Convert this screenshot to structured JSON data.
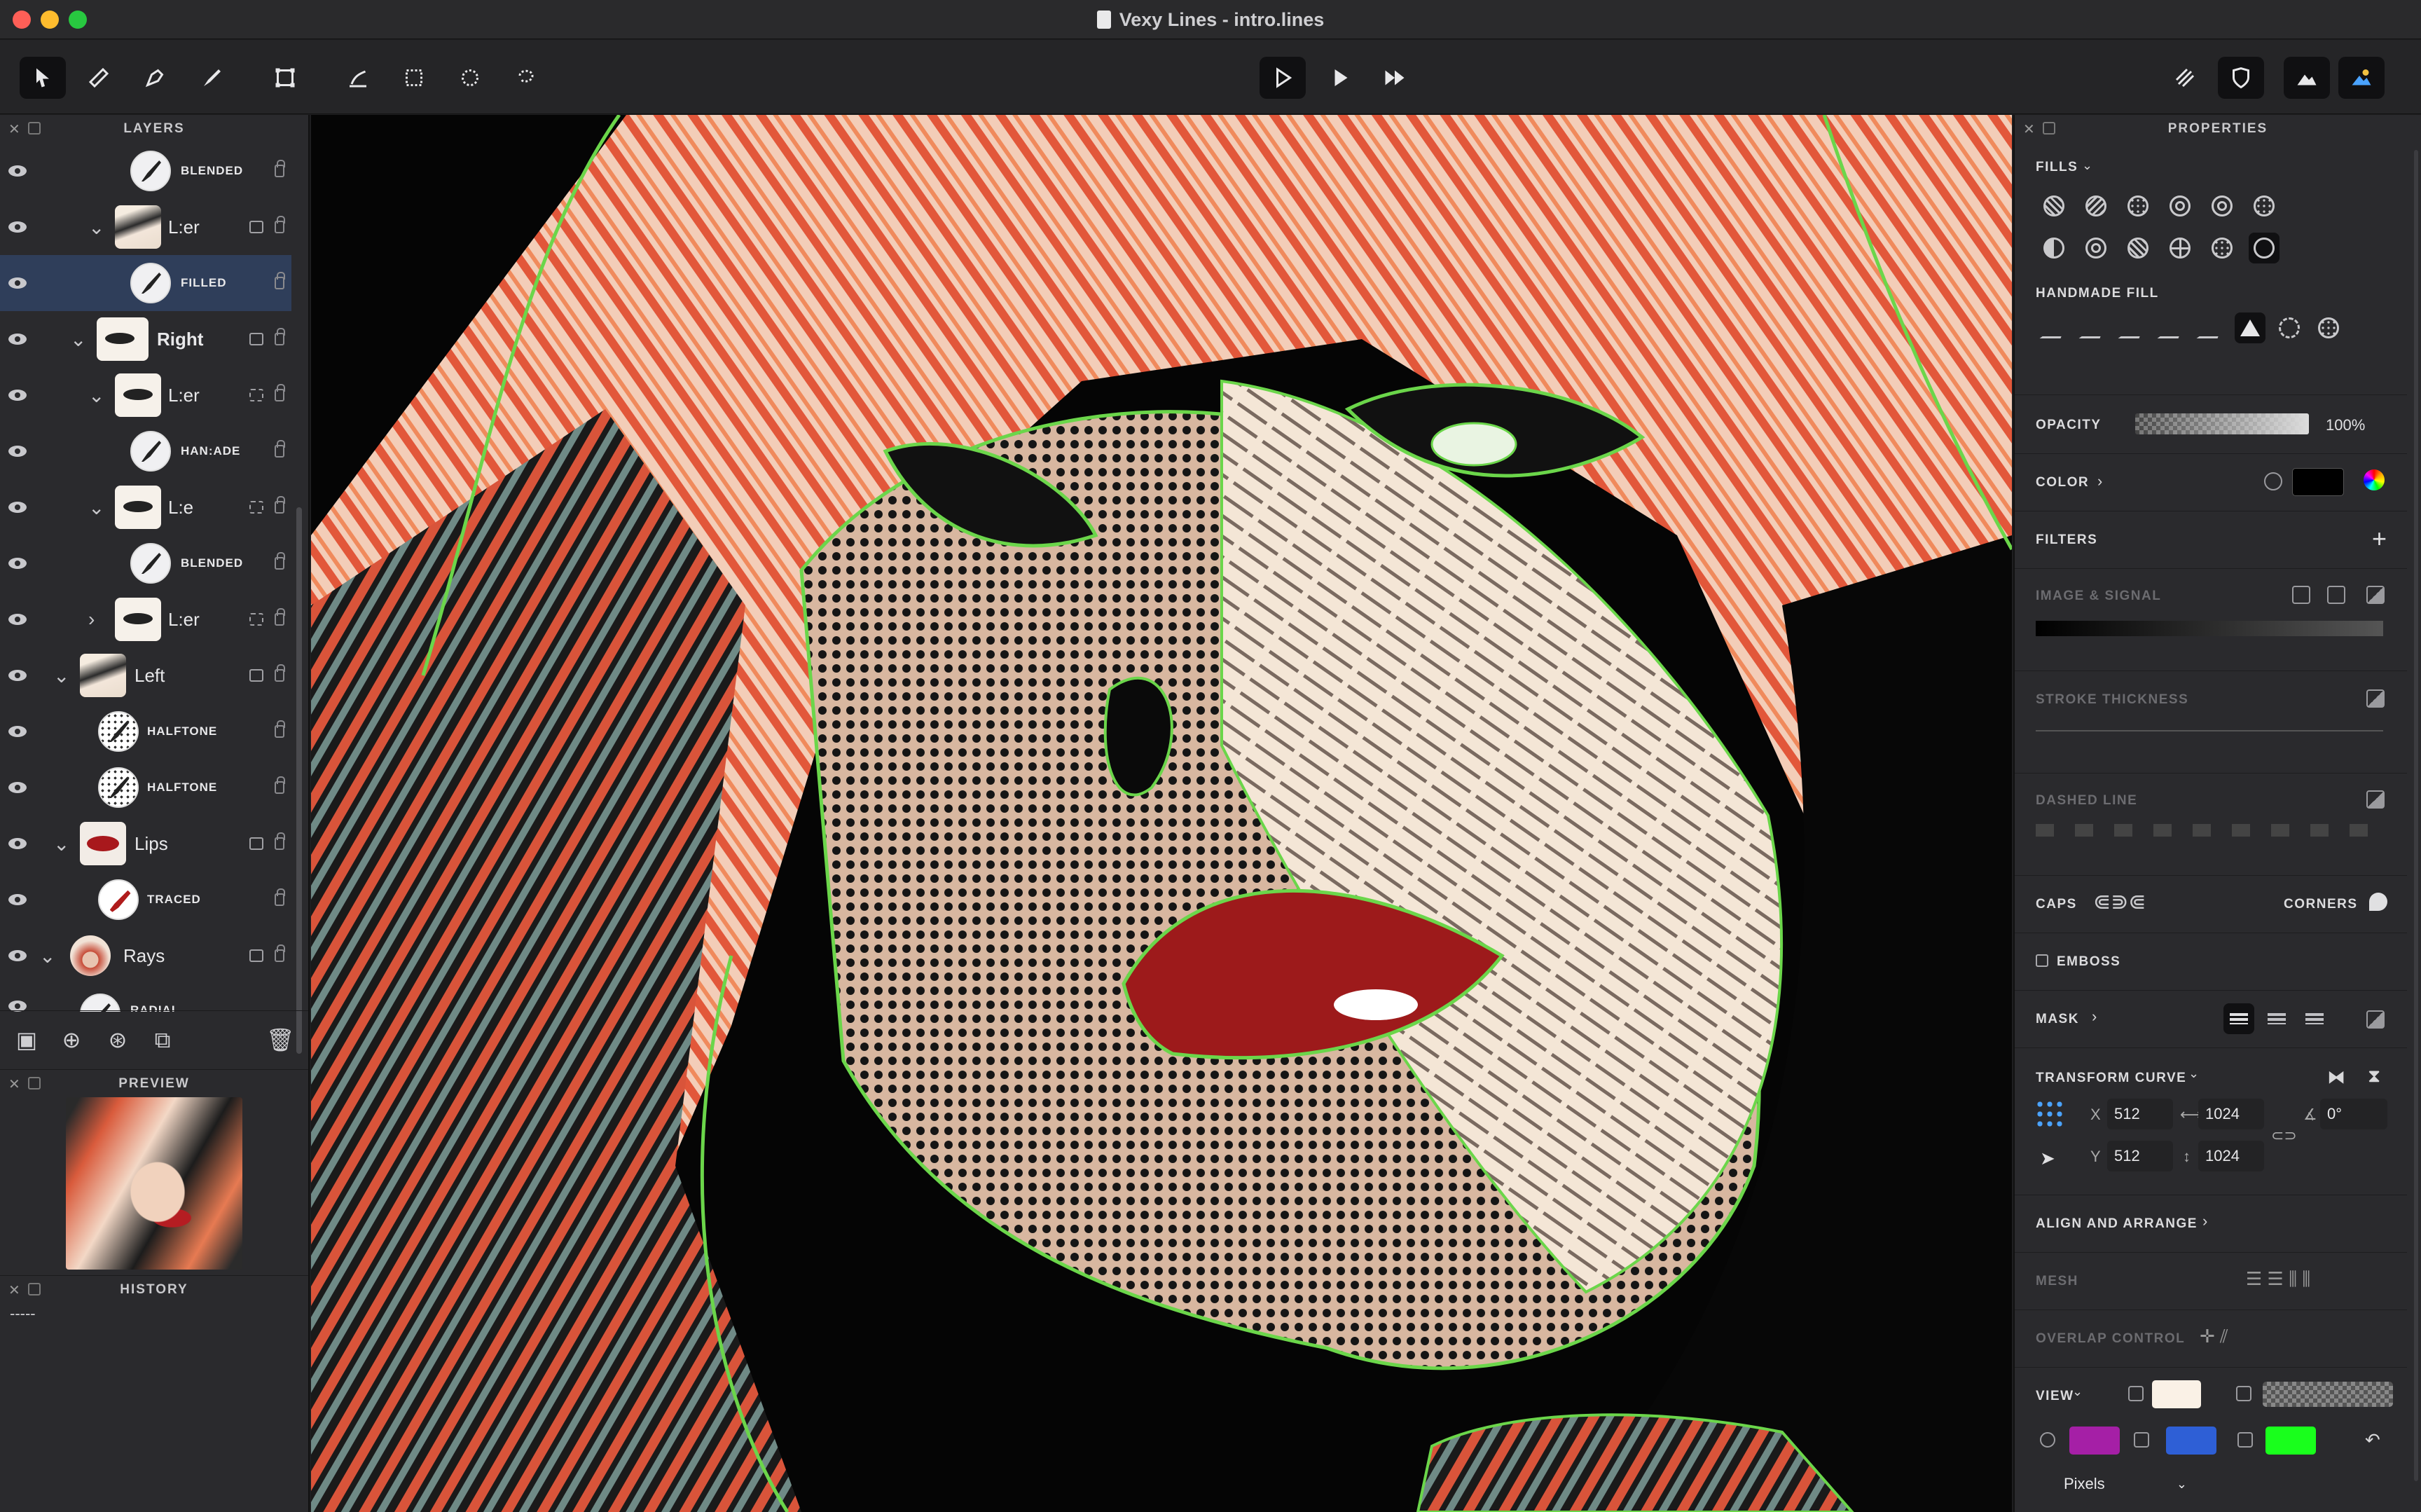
{
  "window": {
    "title": "Vexy Lines - intro.lines"
  },
  "toolbar": {
    "left_tools": [
      "select-tool",
      "ruler-tool",
      "pen-tool",
      "brush-tool",
      "transform-tool",
      "fill-tool",
      "rect-select-tool",
      "ellipse-select-tool",
      "lasso-select-tool"
    ],
    "playback": [
      "render-step",
      "play",
      "fast-forward"
    ],
    "right_tools": [
      "hatch-view",
      "shield-view",
      "mountain-view",
      "image-view"
    ]
  },
  "layers_panel": {
    "title": "LAYERS",
    "rows": [
      {
        "label": "BLENDED",
        "style": "small"
      },
      {
        "label": "L:er",
        "style": "normal"
      },
      {
        "label": "FILLED",
        "style": "small"
      },
      {
        "label": "Right",
        "style": "bold"
      },
      {
        "label": "L:er",
        "style": "normal"
      },
      {
        "label": "HAN:ADE",
        "style": "small"
      },
      {
        "label": "L:e",
        "style": "normal"
      },
      {
        "label": "BLENDED",
        "style": "small"
      },
      {
        "label": "L:er",
        "style": "normal"
      },
      {
        "label": "Left",
        "style": "normal"
      },
      {
        "label": "HALFTONE",
        "style": "small"
      },
      {
        "label": "HALFTONE",
        "style": "small"
      },
      {
        "label": "Lips",
        "style": "normal"
      },
      {
        "label": "TRACED",
        "style": "small"
      },
      {
        "label": "Rays",
        "style": "normal"
      },
      {
        "label": "RADIAL",
        "style": "small"
      }
    ]
  },
  "preview_panel": {
    "title": "PREVIEW"
  },
  "history_panel": {
    "title": "HISTORY",
    "content": "-----"
  },
  "properties": {
    "title": "PROPERTIES",
    "fills_label": "FILLS",
    "handmade_label": "HANDMADE FILL",
    "opacity_label": "OPACITY",
    "opacity_value": "100%",
    "color_label": "COLOR",
    "filters_label": "FILTERS",
    "image_signal_label": "IMAGE & SIGNAL",
    "stroke_thickness_label": "STROKE THICKNESS",
    "dashed_line_label": "DASHED LINE",
    "caps_label": "CAPS",
    "corners_label": "CORNERS",
    "emboss_label": "EMBOSS",
    "mask_label": "MASK",
    "transform_label": "TRANSFORM CURVE",
    "x_label": "X",
    "x_value": "512",
    "y_label": "Y",
    "y_value": "512",
    "w_value": "1024",
    "h_value": "1024",
    "angle_value": "0°",
    "align_label": "ALIGN AND ARRANGE",
    "mesh_label": "MESH",
    "overlap_label": "OVERLAP CONTROL",
    "view_label": "VIEW",
    "units_value": "Pixels",
    "colors": {
      "accent_purple": "#a51fa6",
      "accent_blue": "#2e5fd6",
      "accent_green": "#19ff1c",
      "paper": "#faf1e6"
    }
  }
}
